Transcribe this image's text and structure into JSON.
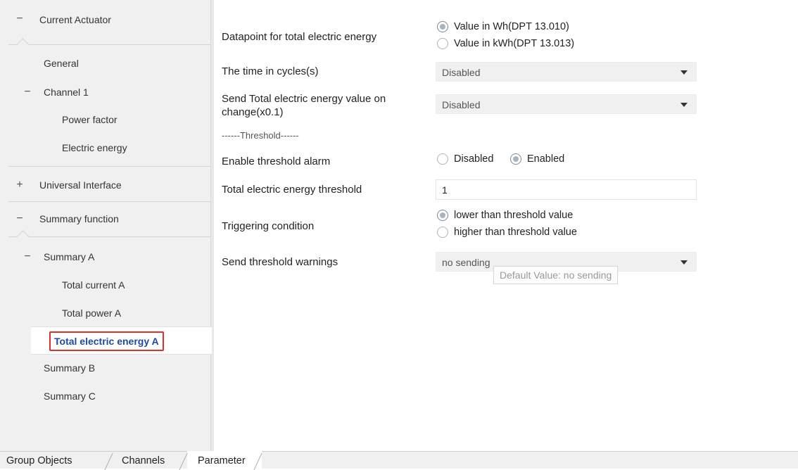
{
  "sidebar": {
    "items": [
      {
        "toggle": "−",
        "label": "Current Actuator"
      },
      {
        "toggle": "",
        "label": "General"
      },
      {
        "toggle": "−",
        "label": "Channel 1"
      },
      {
        "toggle": "",
        "label": "Power factor"
      },
      {
        "toggle": "",
        "label": "Electric energy"
      },
      {
        "toggle": "+",
        "label": "Universal Interface"
      },
      {
        "toggle": "−",
        "label": "Summary function"
      },
      {
        "toggle": "−",
        "label": "Summary A"
      },
      {
        "toggle": "",
        "label": "Total current A"
      },
      {
        "toggle": "",
        "label": "Total power A"
      },
      {
        "toggle": "",
        "label": "Total electric energy A"
      },
      {
        "toggle": "",
        "label": "Summary B"
      },
      {
        "toggle": "",
        "label": "Summary C"
      }
    ]
  },
  "params": {
    "datapoint": {
      "label": "Datapoint for total electric energy",
      "options": [
        "Value in Wh(DPT 13.010)",
        "Value in kWh(DPT 13.013)"
      ],
      "selected": 0
    },
    "cycles": {
      "label": "The time in cycles(s)",
      "value": "Disabled"
    },
    "send_on_change": {
      "label_line1": "Send Total electric energy value on",
      "label_line2": "change(x0.1)",
      "value": "Disabled"
    },
    "threshold_divider": "------Threshold------",
    "enable_alarm": {
      "label": "Enable threshold alarm",
      "options": [
        "Disabled",
        "Enabled"
      ],
      "selected": 1
    },
    "threshold": {
      "label": "Total electric energy threshold",
      "value": "1"
    },
    "trigger": {
      "label": "Triggering condition",
      "options": [
        "lower than threshold value",
        "higher than threshold value"
      ],
      "selected": 0
    },
    "warnings": {
      "label": "Send threshold warnings",
      "value": "no sending",
      "tooltip": "Default Value: no sending"
    }
  },
  "tabs": [
    "Group Objects",
    "Channels",
    "Parameter"
  ],
  "active_tab": "Parameter",
  "colors": {
    "selected_text": "#1f4aa0",
    "highlight_border": "#e0302a"
  }
}
